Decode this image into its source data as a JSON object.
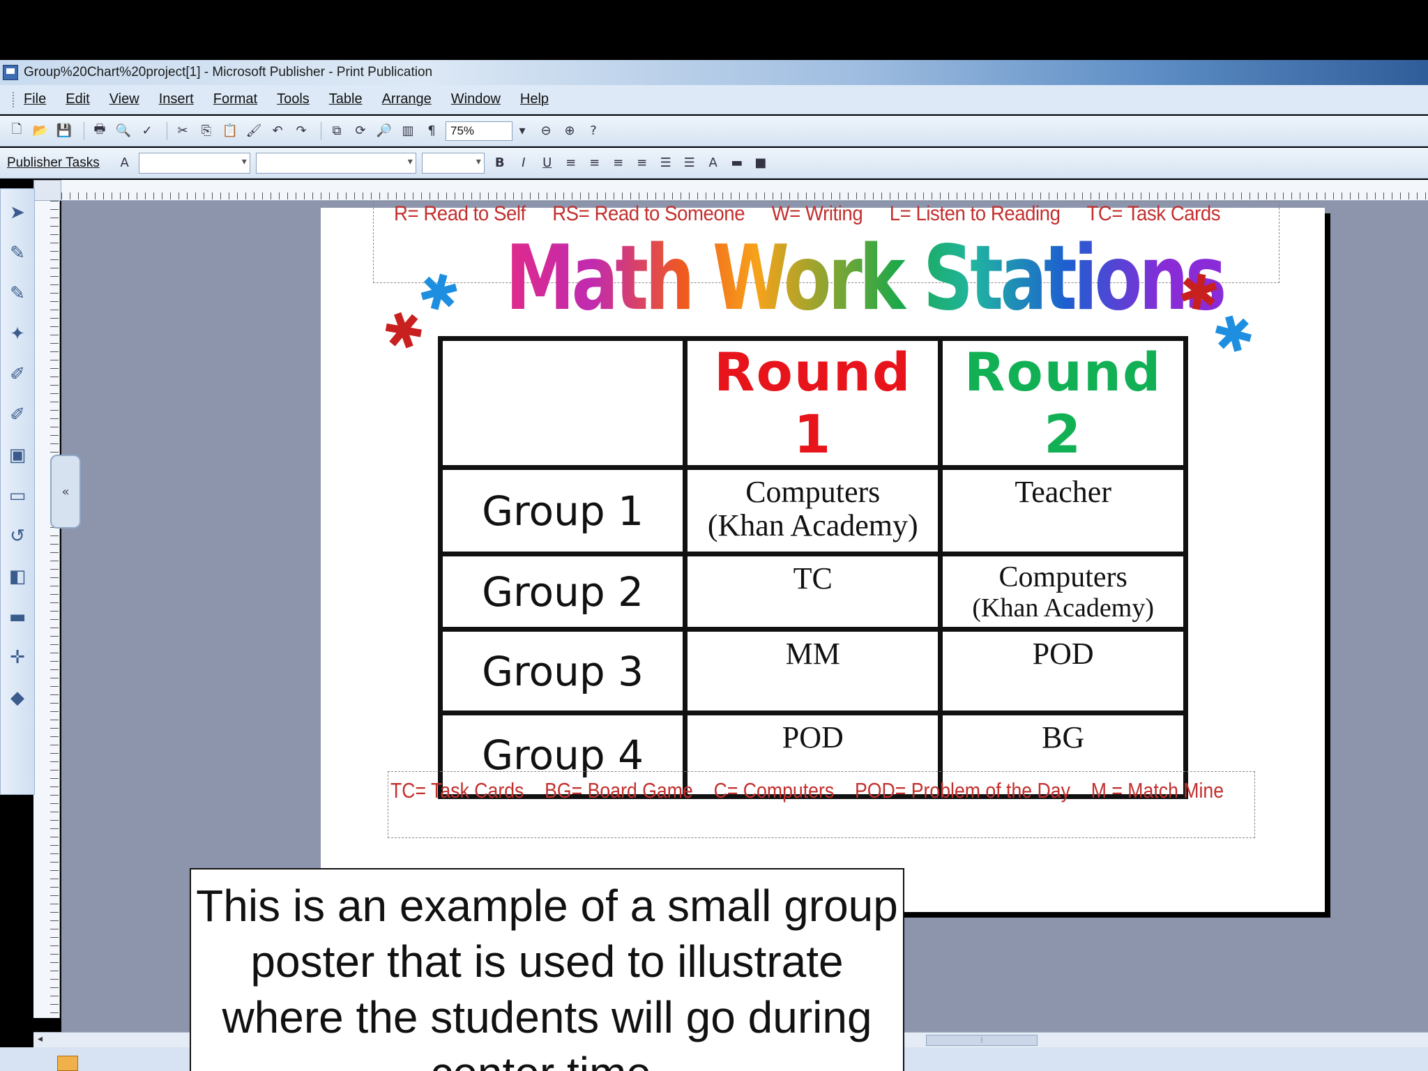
{
  "window": {
    "title": "Group%20Chart%20project[1] - Microsoft Publisher - Print Publication"
  },
  "menu": [
    "File",
    "Edit",
    "View",
    "Insert",
    "Format",
    "Tools",
    "Table",
    "Arrange",
    "Window",
    "Help"
  ],
  "toolbar": {
    "zoom": "75%",
    "publisher_tasks": "Publisher Tasks"
  },
  "poster": {
    "legend_top": [
      "R= Read to Self",
      "RS= Read to Someone",
      "W= Writing",
      "L= Listen to Reading",
      "TC= Task Cards"
    ],
    "title": "Math Work Stations",
    "table": {
      "headers": [
        "",
        "Round 1",
        "Round 2"
      ],
      "rows": [
        {
          "group": "Group 1",
          "round1": [
            "Computers",
            "(Khan Academy)"
          ],
          "round2": [
            "Teacher",
            ""
          ]
        },
        {
          "group": "Group 2",
          "round1": [
            "TC",
            ""
          ],
          "round2": [
            "Computers",
            "(Khan Academy)"
          ]
        },
        {
          "group": "Group 3",
          "round1": [
            "MM",
            ""
          ],
          "round2": [
            "POD",
            ""
          ]
        },
        {
          "group": "Group 4",
          "round1": [
            "POD",
            ""
          ],
          "round2": [
            "BG",
            ""
          ]
        }
      ]
    },
    "legend_bottom": [
      "TC= Task Cards",
      "BG= Board  Game",
      "C= Computers",
      "POD= Problem of the Day",
      "M = Match Mine"
    ]
  },
  "caption": {
    "text": "This is an example of a small group poster that is used to illustrate where the students will go during center time."
  },
  "colors": {
    "round1": "#e8141b",
    "round2": "#12b054",
    "legend": "#c2302e",
    "workspace": "#8d95ad"
  },
  "icons": [
    "select-arrow-icon",
    "text-box-icon",
    "table-icon",
    "wordart-icon",
    "picture-icon",
    "shape-icon",
    "undo-icon"
  ]
}
